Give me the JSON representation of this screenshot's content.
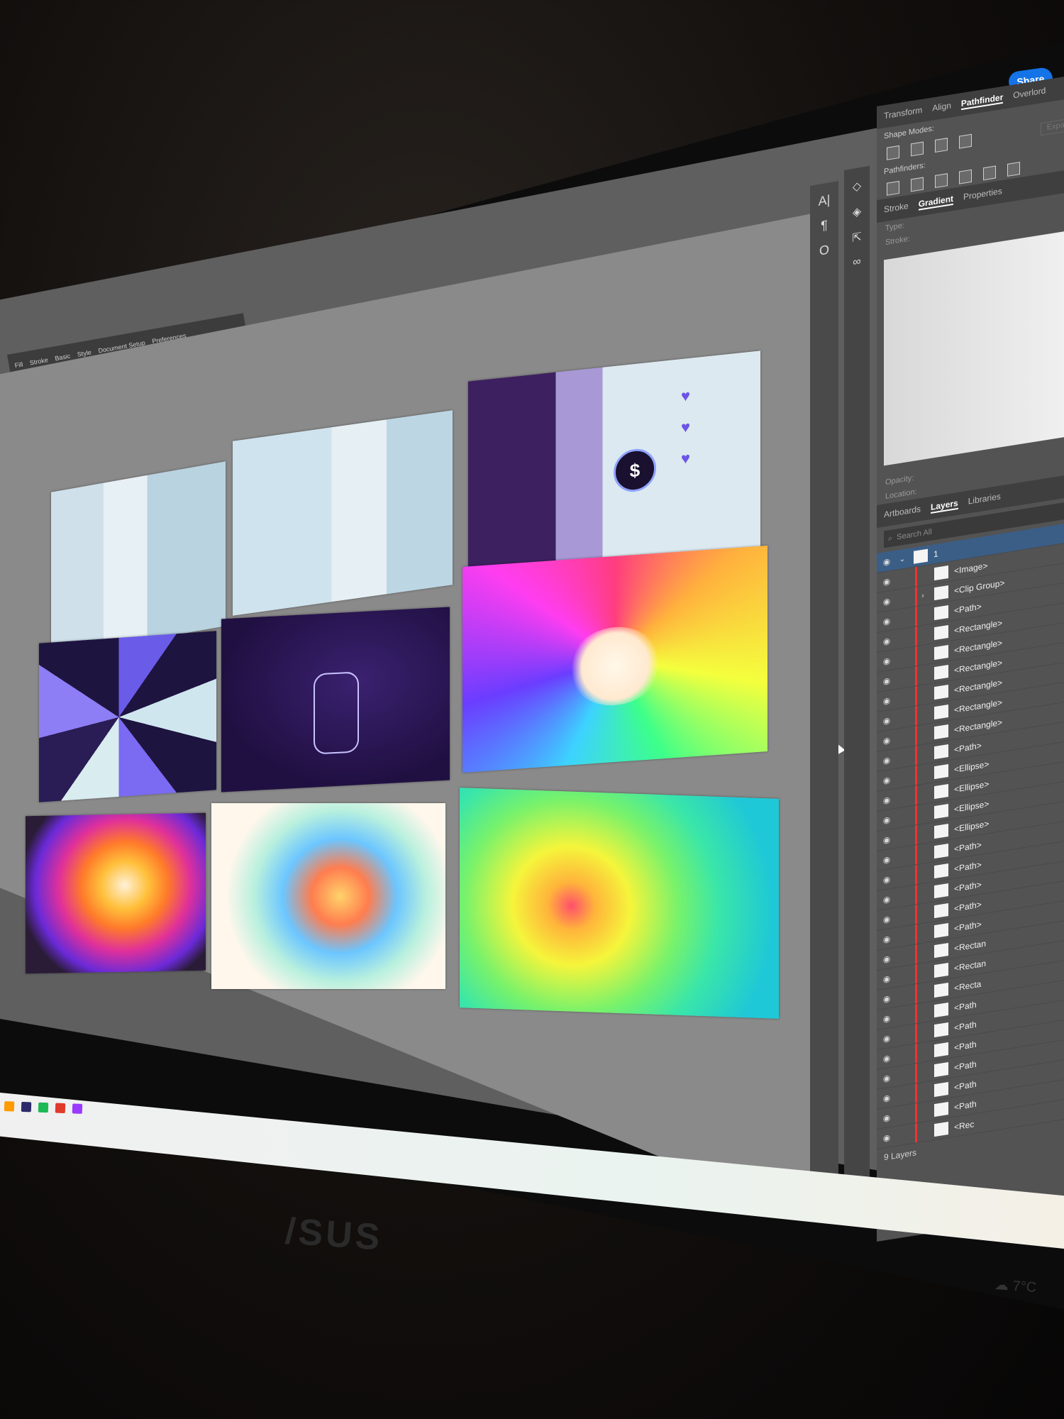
{
  "app": {
    "share_label": "Share",
    "monitor_brand": "/SUS",
    "weather": "7°C",
    "control_bar": [
      "Fill",
      "Stroke",
      "Basic",
      "Style",
      "Document Setup",
      "Preferences"
    ]
  },
  "panel": {
    "top_tabs": [
      "Transform",
      "Align",
      "Pathfinder",
      "Overlord"
    ],
    "active_top_tab": "Pathfinder",
    "shape_modes_label": "Shape Modes:",
    "pathfinders_label": "Pathfinders:",
    "expand_label": "Expand",
    "mid_tabs": [
      "Stroke",
      "Gradient",
      "Properties"
    ],
    "active_mid_tab": "Gradient",
    "type_label": "Type:",
    "stroke_label": "Stroke:",
    "opacity_label": "Opacity:",
    "location_label": "Location:",
    "bottom_tabs": [
      "Artboards",
      "Layers",
      "Libraries"
    ],
    "active_bottom_tab": "Layers",
    "search_placeholder": "Search All",
    "layer_parent": "1",
    "layers": [
      "<Image>",
      "<Clip Group>",
      "<Path>",
      "<Rectangle>",
      "<Rectangle>",
      "<Rectangle>",
      "<Rectangle>",
      "<Rectangle>",
      "<Rectangle>",
      "<Path>",
      "<Ellipse>",
      "<Ellipse>",
      "<Ellipse>",
      "<Ellipse>",
      "<Path>",
      "<Path>",
      "<Path>",
      "<Path>",
      "<Path>",
      "<Rectan",
      "<Rectan",
      "<Recta",
      "<Path",
      "<Path",
      "<Path",
      "<Path",
      "<Path",
      "<Path",
      "<Rec"
    ],
    "layer_count": "9 Layers"
  },
  "colors": {
    "accent": "#1473e6",
    "layer_marker": "#ee3333",
    "panel_bg": "#535353"
  },
  "icons": [
    "eye-icon",
    "search-icon",
    "chevron-down-icon",
    "chevron-right-icon",
    "cloud-icon",
    "dollar-icon",
    "heart-icon"
  ]
}
